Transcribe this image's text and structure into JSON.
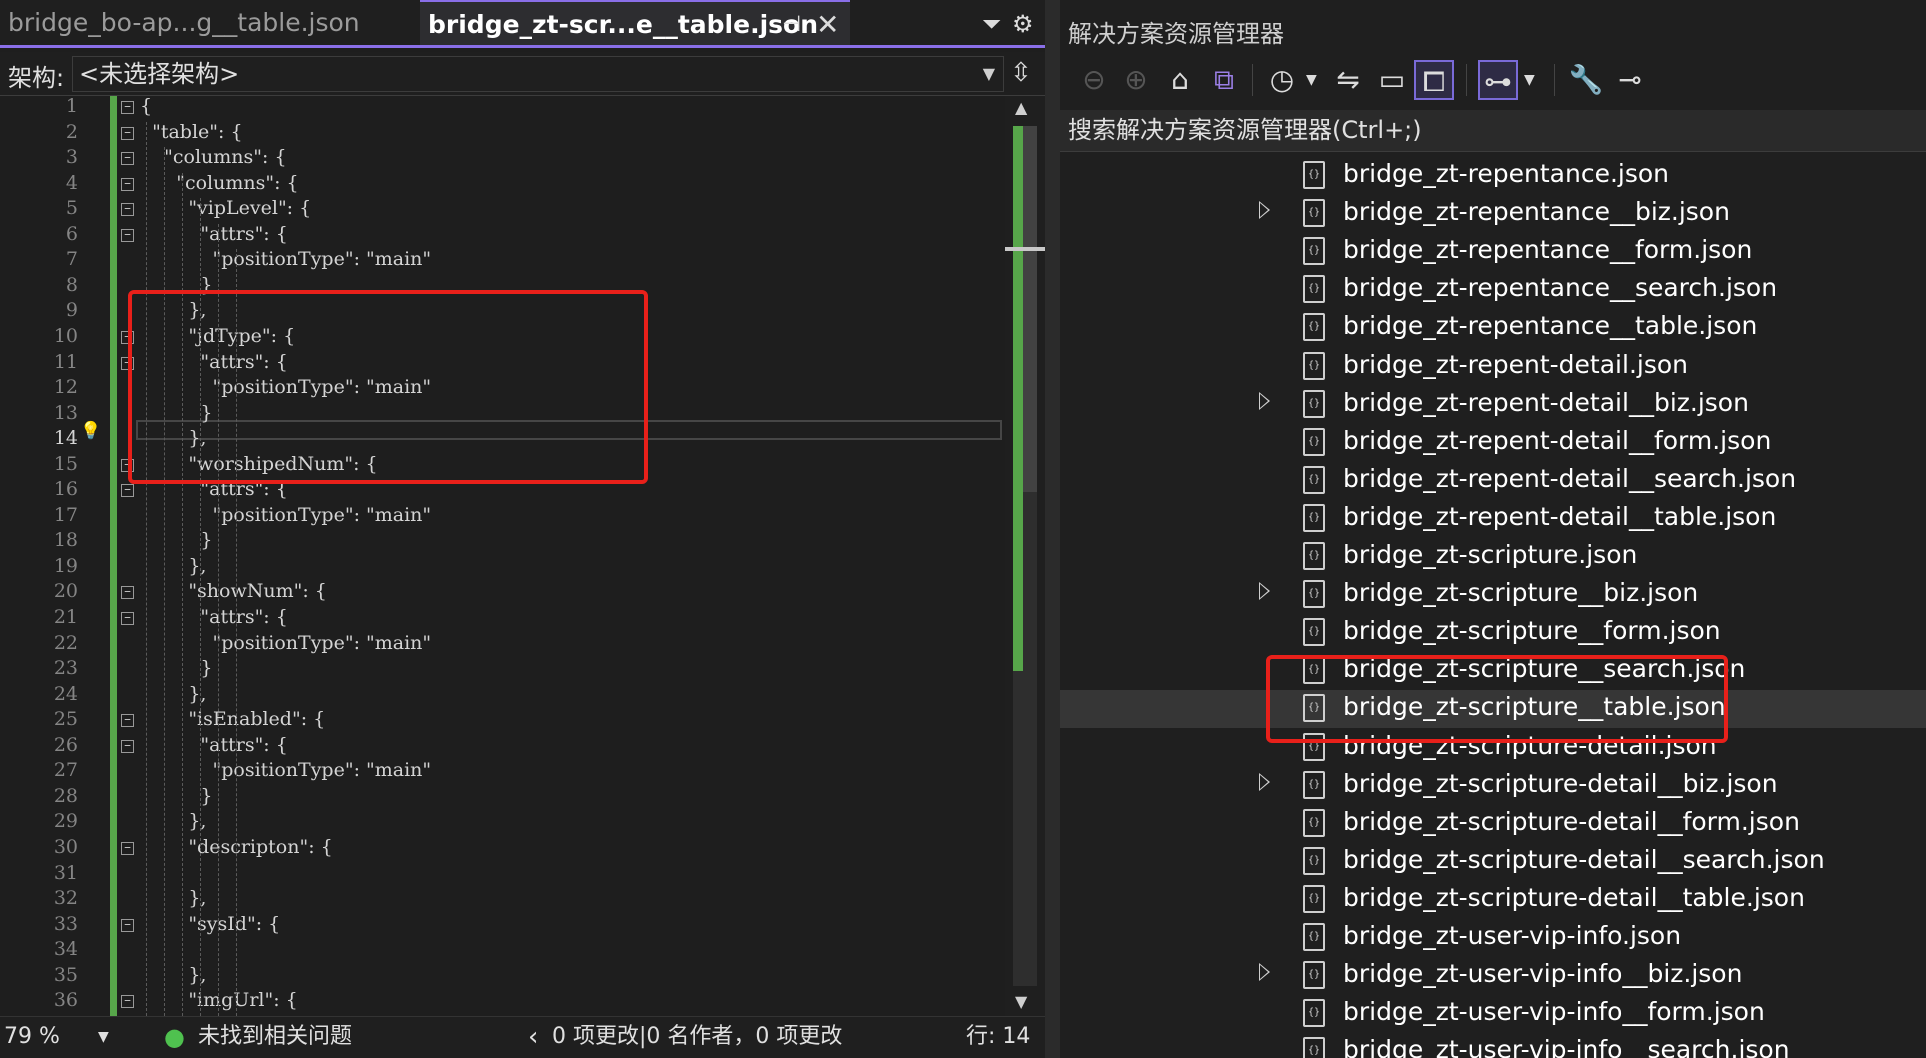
{
  "editor": {
    "tabs": [
      {
        "label": "bridge_bo-ap...g__table.json",
        "active": false
      },
      {
        "label": "bridge_zt-scr...e__table.json",
        "active": true
      }
    ],
    "pin_glyph": "⊣",
    "close_glyph": "✕",
    "tab_menu_icon": "dropdown-list-icon",
    "settings_icon": "gear-icon",
    "nav_label": "架构:",
    "nav_value": "<未选择架构>",
    "code_lines": [
      "{",
      "  \"table\": {",
      "    \"columns\": {",
      "      \"columns\": {",
      "        \"vipLevel\": {",
      "          \"attrs\": {",
      "            \"positionType\": \"main\"",
      "          }",
      "        },",
      "        \"jdType\": {",
      "          \"attrs\": {",
      "            \"positionType\": \"main\"",
      "          }",
      "        },",
      "        \"worshipedNum\": {",
      "          \"attrs\": {",
      "            \"positionType\": \"main\"",
      "          }",
      "        },",
      "        \"showNum\": {",
      "          \"attrs\": {",
      "            \"positionType\": \"main\"",
      "          }",
      "        },",
      "        \"isEnabled\": {",
      "          \"attrs\": {",
      "            \"positionType\": \"main\"",
      "          }",
      "        },",
      "        \"descripton\": {",
      "",
      "        },",
      "        \"sysId\": {",
      "",
      "        },",
      "        \"imgUrl\": {"
    ],
    "current_line": 14,
    "status": {
      "zoom": "79 %",
      "issues": "未找到相关问题",
      "changes": "0 项更改|0 名作者，0 项更改",
      "line": "行: 14"
    }
  },
  "explorer": {
    "title": "解决方案资源管理器",
    "search_placeholder": "搜索解决方案资源管理器(Ctrl+;)",
    "toolbar_icons": [
      "back-icon",
      "forward-icon",
      "home-icon",
      "vs-switch-views-icon",
      "pending-changes-icon",
      "sync-icon",
      "collapse-all-icon",
      "show-all-files-icon",
      "preview-selected-icon",
      "properties-icon",
      "settings-icon"
    ],
    "files": [
      {
        "name": "bridge_zt-repentance.json",
        "expandable": false
      },
      {
        "name": "bridge_zt-repentance__biz.json",
        "expandable": true
      },
      {
        "name": "bridge_zt-repentance__form.json",
        "expandable": false
      },
      {
        "name": "bridge_zt-repentance__search.json",
        "expandable": false
      },
      {
        "name": "bridge_zt-repentance__table.json",
        "expandable": false
      },
      {
        "name": "bridge_zt-repent-detail.json",
        "expandable": false
      },
      {
        "name": "bridge_zt-repent-detail__biz.json",
        "expandable": true
      },
      {
        "name": "bridge_zt-repent-detail__form.json",
        "expandable": false
      },
      {
        "name": "bridge_zt-repent-detail__search.json",
        "expandable": false
      },
      {
        "name": "bridge_zt-repent-detail__table.json",
        "expandable": false
      },
      {
        "name": "bridge_zt-scripture.json",
        "expandable": false
      },
      {
        "name": "bridge_zt-scripture__biz.json",
        "expandable": true
      },
      {
        "name": "bridge_zt-scripture__form.json",
        "expandable": false
      },
      {
        "name": "bridge_zt-scripture__search.json",
        "expandable": false
      },
      {
        "name": "bridge_zt-scripture__table.json",
        "expandable": false,
        "selected": true
      },
      {
        "name": "bridge_zt-scripture-detail.json",
        "expandable": false
      },
      {
        "name": "bridge_zt-scripture-detail__biz.json",
        "expandable": true
      },
      {
        "name": "bridge_zt-scripture-detail__form.json",
        "expandable": false
      },
      {
        "name": "bridge_zt-scripture-detail__search.json",
        "expandable": false
      },
      {
        "name": "bridge_zt-scripture-detail__table.json",
        "expandable": false
      },
      {
        "name": "bridge_zt-user-vip-info.json",
        "expandable": false
      },
      {
        "name": "bridge_zt-user-vip-info__biz.json",
        "expandable": true
      },
      {
        "name": "bridge_zt-user-vip-info__form.json",
        "expandable": false
      },
      {
        "name": "bridge_zt-user-vip-info__search.json",
        "expandable": false
      }
    ]
  },
  "colors": {
    "accent": "#8a6fe8",
    "annotation_red": "#e8201a",
    "json_key": "#d6a56f",
    "change_green": "#57a64a"
  }
}
